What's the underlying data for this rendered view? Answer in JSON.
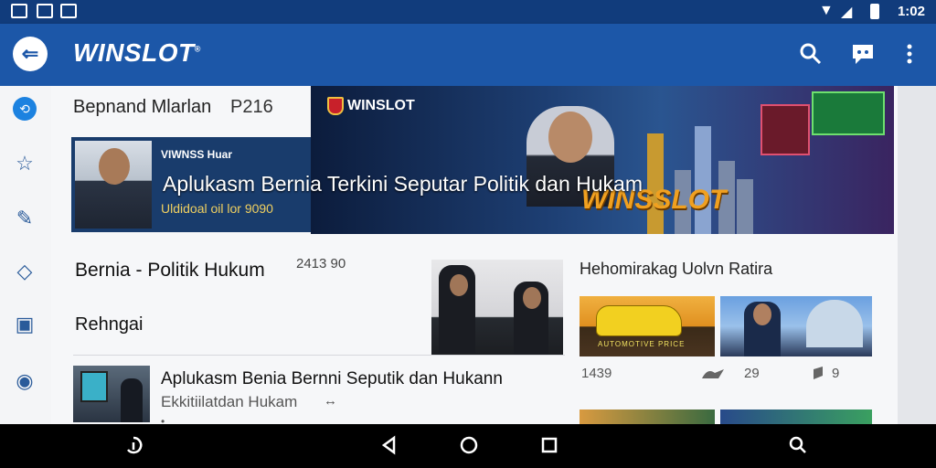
{
  "status_bar": {
    "time": "1:02",
    "icons": [
      "image-notification-icon",
      "message-notification-icon",
      "download-notification-icon",
      "wifi-icon",
      "signal-icon",
      "battery-icon"
    ]
  },
  "app_bar": {
    "title": "WINSLOT",
    "trademark": "®",
    "actions": [
      "search-icon",
      "chat-icon",
      "more-icon"
    ]
  },
  "side_rail": {
    "items": [
      "explore-icon",
      "star-icon",
      "edit-icon",
      "tag-icon",
      "bookmark-icon",
      "record-icon"
    ]
  },
  "top_section": {
    "header": "Bepnand Mlarlan",
    "header_number": "P216"
  },
  "hero": {
    "source": "VIWNSS Huar",
    "headline": "Aplukasm Bernia Terkini Seputar Politik dan Hukam",
    "date": "Uldidoal oil lor 9090"
  },
  "banner": {
    "logo_text": "WINSLOT",
    "brand_text": "WINSSLOT"
  },
  "feed": {
    "title": "Bernia - Politik Hukum",
    "count": "2413 90",
    "subtitle": "Rehngai"
  },
  "list_item": {
    "title": "Aplukasm Benia Bernni Seputik dan Hukann",
    "subtitle": "Ekkitiilatdan Hukam",
    "subtitle_icon": "↔",
    "dot": "•"
  },
  "right_panel": {
    "title": "Hehomirakag Uolvn Ratira",
    "card_caption": "AUTOMOTIVE PRICE",
    "stats": {
      "views": "1439",
      "likes": "29",
      "shares": "9"
    }
  },
  "nav_bar": {
    "buttons": [
      "assistant-icon",
      "back-icon",
      "home-icon",
      "recents-icon",
      "search-icon"
    ]
  },
  "colors": {
    "status_bar": "#113c7c",
    "app_bar": "#1c57a8",
    "accent": "#1c82e0",
    "brand_orange": "#f0a020"
  }
}
